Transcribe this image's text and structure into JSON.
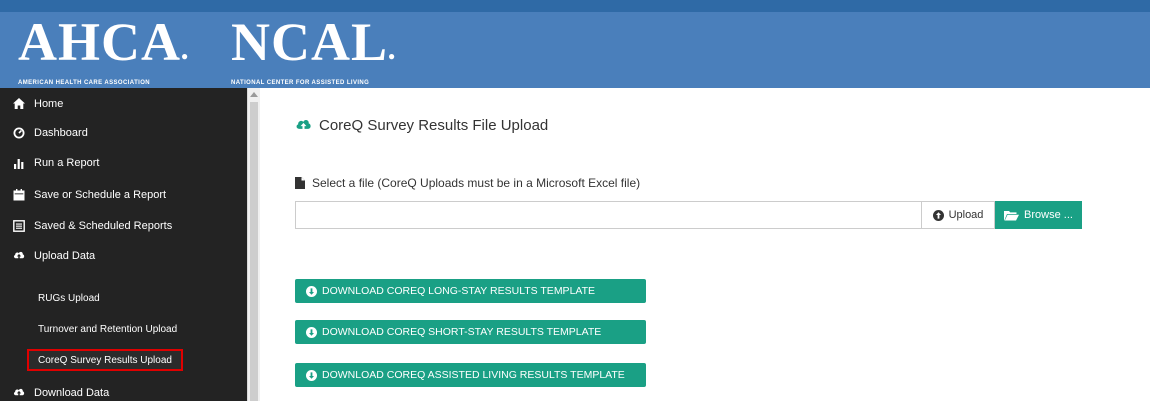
{
  "header": {
    "logo_left_main": "AHCA",
    "logo_left_sub": "AMERICAN HEALTH CARE ASSOCIATION",
    "logo_right_main": "NCAL",
    "logo_right_sub": "NATIONAL CENTER FOR ASSISTED LIVING",
    "brand_color": "#4a7fbb",
    "topbar_color": "#2f6aa6"
  },
  "sidebar": {
    "items": [
      {
        "label": "Home",
        "icon": "home-icon"
      },
      {
        "label": "Dashboard",
        "icon": "gauge-icon"
      },
      {
        "label": "Run a Report",
        "icon": "bar-chart-icon"
      },
      {
        "label": "Save or Schedule a Report",
        "icon": "calendar-icon"
      },
      {
        "label": "Saved & Scheduled Reports",
        "icon": "list-icon"
      },
      {
        "label": "Upload Data",
        "icon": "cloud-upload-icon"
      }
    ],
    "sub_items": [
      {
        "label": "RUGs Upload"
      },
      {
        "label": "Turnover and Retention Upload"
      },
      {
        "label": "CoreQ Survey Results Upload",
        "active": true
      }
    ],
    "bottom_item": {
      "label": "Download Data",
      "icon": "cloud-download-icon"
    },
    "active_outline_color": "#e00000"
  },
  "main": {
    "title": "CoreQ Survey Results File Upload",
    "file_label": "Select a file (CoreQ Uploads must be in a Microsoft Excel file)",
    "file_input_value": "",
    "upload_label": "Upload",
    "browse_label": "Browse ...",
    "accent_color": "#1aa085",
    "downloads": [
      {
        "label": "DOWNLOAD COREQ LONG-STAY RESULTS TEMPLATE"
      },
      {
        "label": "DOWNLOAD COREQ SHORT-STAY RESULTS TEMPLATE"
      },
      {
        "label": "DOWNLOAD COREQ ASSISTED LIVING RESULTS TEMPLATE"
      }
    ]
  }
}
